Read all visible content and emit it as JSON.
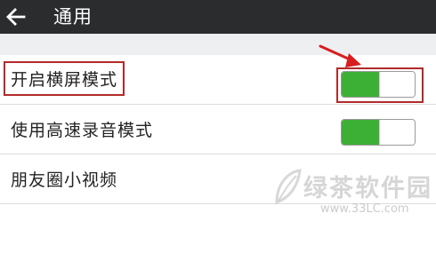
{
  "header": {
    "title": "通用",
    "back_icon": "arrow-left-icon"
  },
  "settings": {
    "items": [
      {
        "label": "开启横屏模式",
        "toggle": true,
        "on": true
      },
      {
        "label": "使用高速录音模式",
        "toggle": true,
        "on": true
      },
      {
        "label": "朋友圈小视频",
        "toggle": false
      },
      {
        "label": "",
        "toggle": false
      }
    ]
  },
  "annotations": {
    "highlight_color": "#b22a2a",
    "arrow_color": "#d81e1e"
  },
  "colors": {
    "topbar": "#2a2c2d",
    "toggle_on": "#3cb034",
    "section_gap": "#eeeff1"
  },
  "watermark": {
    "text": "绿茶软件园",
    "url": "www.33LC.com"
  }
}
